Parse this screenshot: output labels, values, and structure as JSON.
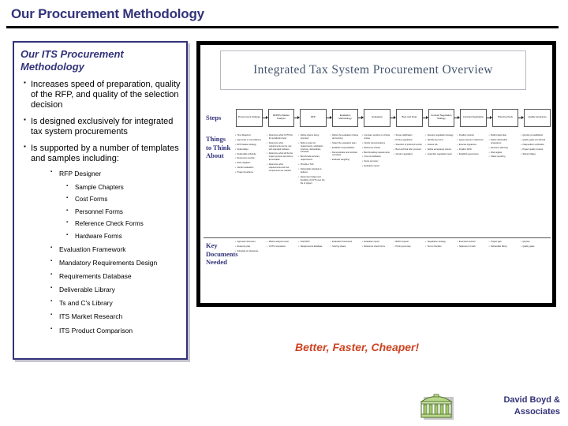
{
  "slide": {
    "title": "Our Procurement Methodology",
    "tagline": "Better, Faster, Cheaper!",
    "title_color": "#33337a",
    "tagline_color": "#cc4422"
  },
  "panel": {
    "heading": "Our ITS Procurement Methodology",
    "bullets": [
      "Increases speed of preparation, quality of the RFP, and quality of the selection decision",
      "Is designed exclusively for integrated tax system procurements",
      "Is supported by a number of templates and samples including:"
    ],
    "sub_items": [
      "RFP Designer",
      "Evaluation Framework",
      "Mandatory Requirements Design",
      "Requirements Database",
      "Deliverable Library",
      "Ts and C's Library",
      "ITS Market Research",
      "ITS Product Comparison"
    ],
    "rfp_designer_children": [
      "Sample Chapters",
      "Cost Forms",
      "Personnel Forms",
      "Reference Check Forms",
      "Hardware Forms"
    ],
    "border_color": "#33337a"
  },
  "diagram": {
    "title": "Integrated Tax System Procurement Overview",
    "title_color": "#44546e",
    "rows": [
      {
        "label": "Steps"
      },
      {
        "label": "Things to Think About"
      },
      {
        "label": "Key Documents Needed"
      }
    ],
    "steps": [
      "Procurement Strategy",
      "RFP/Pre-Market Analysis",
      "RFP",
      "Evaluation Methodology",
      "Evaluation",
      "Best and Final",
      "Contract Negotiation Strategy",
      "Contract Negotiation",
      "Planning Tools",
      "Quality Assurance"
    ],
    "think_about": [
      [
        "Time Required",
        "Approvals or consultations",
        "RFP release strategy",
        "Deliverables",
        "Deliverable schedule",
        "Resources needed",
        "Risk mitigation",
        "Vendor evaluation",
        "Project timeframe"
      ],
      [
        "Determine what COTS fits the jurisdiction best",
        "Determine what requirements can be met with standard software",
        "Determine what will be the project process and who is accountable",
        "Determine what requirements and cost components are needed"
      ],
      [
        "Define what is being procured",
        "Build a scope for requirements, solicitation structure, deliverables, schedule",
        "Benchmark accuracy requirements",
        "Provide a T&C",
        "Deliverable schedule is defined",
        "Determine budget and flexibility of COTS over the life of project"
      ],
      [
        "Define the evaluation criteria and scoring",
        "Select the evaluation team",
        "Establish responsibilities",
        "Demonstration and scripted scenarios",
        "Evaluate weighting"
      ],
      [
        "Compare vendors on criteria scores",
        "Vendor demonstrations",
        "Reference checks",
        "Benchmarking requirements",
        "Cost normalization",
        "Score summary",
        "Evaluation report"
      ],
      [
        "Scope clarification",
        "Pricing negotiation",
        "Selection of preferred vendor",
        "Best and final offer received",
        "Vendor negotiation"
      ],
      [
        "Develop negotiation strategy",
        "Identify key terms",
        "Assess risk",
        "Define acceptance criteria",
        "Assemble negotiation team"
      ],
      [
        "Finalize contract",
        "Agree payment milestones",
        "Execute signatures",
        "Finalize SOW",
        "Establish governance"
      ],
      [
        "Build project plan",
        "Define deliverable acceptance",
        "Resource planning",
        "Risk register",
        "Status reporting"
      ],
      [
        "QA plan is established",
        "Quality gates are defined",
        "Independent verification",
        "Project quality reviews",
        "Status bridges"
      ]
    ],
    "key_documents": [
      [
        "Approach document",
        "Resource plan",
        "Schedule of milestones"
      ],
      [
        "Market analysis report",
        "COTS comparison"
      ],
      [
        "Draft RFP",
        "Requirements database"
      ],
      [
        "Evaluation framework",
        "Scoring sheets"
      ],
      [
        "Evaluation report",
        "Reference check forms"
      ],
      [
        "BAFO request",
        "Pricing summary"
      ],
      [
        "Negotiation strategy",
        "Terms checklist"
      ],
      [
        "Executed contract",
        "Statement of work"
      ],
      [
        "Project plan",
        "Deliverable library"
      ],
      [
        "QA plan",
        "Quality gates"
      ]
    ]
  },
  "footer": {
    "company_line1": "David Boyd &",
    "company_line2": "Associates",
    "logo_name": "capitol-building-logo",
    "company_color": "#33337a",
    "logo_color": "#a8cc78"
  }
}
